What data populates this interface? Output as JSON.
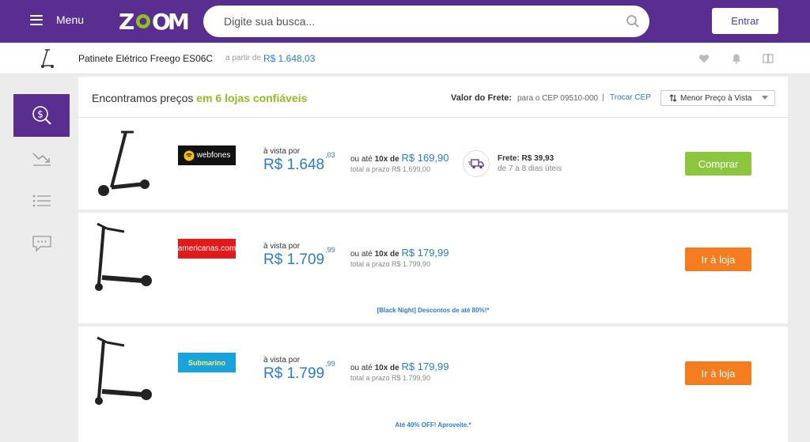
{
  "header": {
    "menu_label": "Menu",
    "logo_text": "ZOOM",
    "search_placeholder": "Digite sua busca...",
    "login_label": "Entrar"
  },
  "product": {
    "name": "Patinete Elétrico Freego ES06C",
    "from_label": "a partir de",
    "from_price": "R$ 1.648,03"
  },
  "offers_header": {
    "found_prefix": "Encontramos preços",
    "found_highlight": "em 6 lojas confiáveis",
    "shipping_label": "Valor do Frete:",
    "shipping_cep": "para o CEP 09510-000",
    "separator": "|",
    "change_cep": "Trocar CEP",
    "sort_label": "Menor Preço à Vista"
  },
  "offers": [
    {
      "store": "webfones",
      "cash_label": "à vista por",
      "price_int": "R$ 1.648",
      "price_cents": ",03",
      "installment_prefix": "ou até",
      "installment_count": "10x de",
      "installment_value": "R$ 169,90",
      "installment_total": "total a prazo R$ 1.699,00",
      "shipping": "Frete: R$ 39,93",
      "shipping_days": "de 7 a 8 dias úteis",
      "cta": "Comprar",
      "cta_color": "#8cc63f",
      "promo": ""
    },
    {
      "store": "americanas.com",
      "cash_label": "à vista por",
      "price_int": "R$ 1.709",
      "price_cents": ",99",
      "installment_prefix": "ou até",
      "installment_count": "10x de",
      "installment_value": "R$ 179,99",
      "installment_total": "total a prazo R$ 1.799,90",
      "cta": "Ir à loja",
      "cta_color": "#f57c1f",
      "promo": "[Black Night] Descontos de até 80%!*"
    },
    {
      "store": "Submarino",
      "cash_label": "à vista por",
      "price_int": "R$ 1.799",
      "price_cents": ",99",
      "installment_prefix": "ou até",
      "installment_count": "10x de",
      "installment_value": "R$ 179,99",
      "installment_total": "total a prazo R$ 1.799,90",
      "cta": "Ir à loja",
      "cta_color": "#f57c1f",
      "promo": "Até 40% OFF! Aproveite.*"
    }
  ],
  "colors": {
    "brand": "#5a2d91",
    "accent_green": "#8cc21f",
    "price_blue": "#2a7bd5",
    "orange": "#f57c1f"
  }
}
